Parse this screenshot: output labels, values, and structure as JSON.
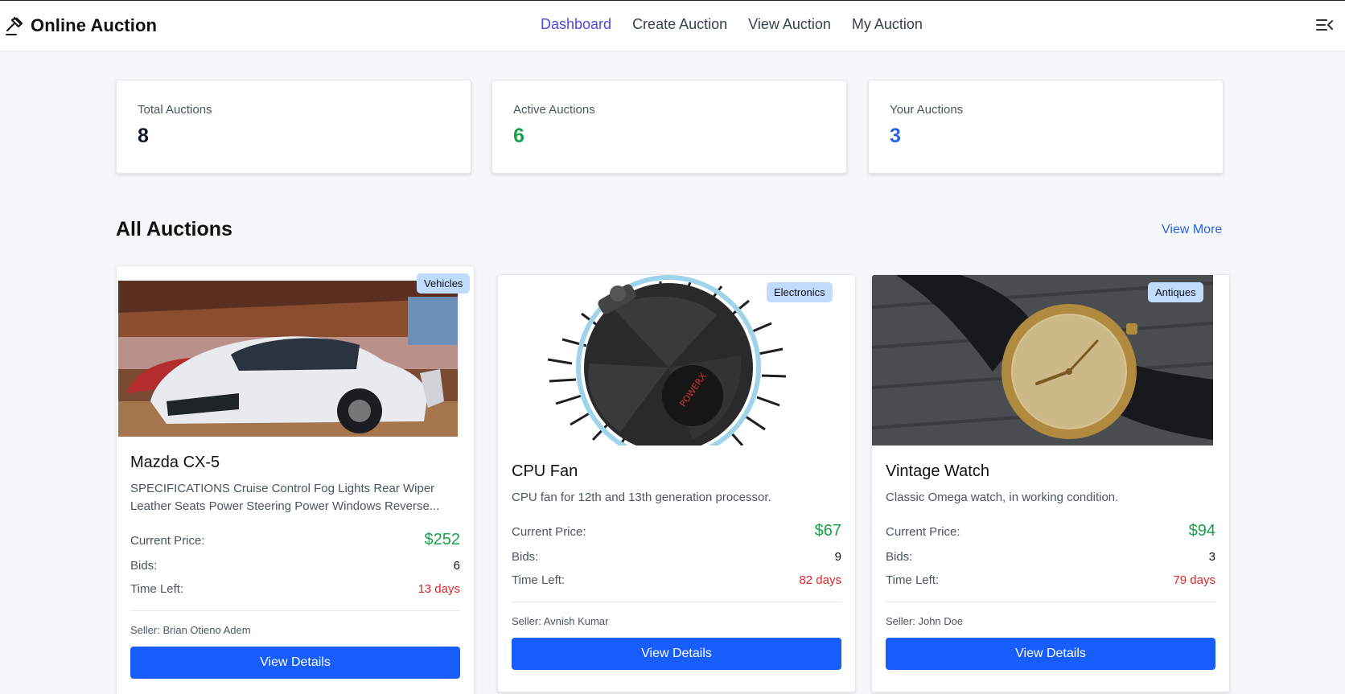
{
  "header": {
    "brand": "Online Auction",
    "nav": [
      "Dashboard",
      "Create Auction",
      "View Auction",
      "My Auction"
    ],
    "active_nav": "Dashboard"
  },
  "stats": [
    {
      "label": "Total Auctions",
      "value": "8",
      "color": "#111827"
    },
    {
      "label": "Active Auctions",
      "value": "6",
      "color": "#16a34a"
    },
    {
      "label": "Your Auctions",
      "value": "3",
      "color": "#2563eb"
    }
  ],
  "section": {
    "title": "All Auctions",
    "view_more": "View More"
  },
  "labels": {
    "current_price": "Current Price:",
    "bids": "Bids:",
    "time_left": "Time Left:",
    "view_details": "View Details"
  },
  "auctions": [
    {
      "category": "Vehicles",
      "title": "Mazda CX-5",
      "description": "SPECIFICATIONS Cruise Control Fog Lights Rear Wiper Leather Seats Power Steering Power Windows Reverse...",
      "price": "$252",
      "bids": "6",
      "time_left": "13 days",
      "seller": "Seller: Brian Otieno Adem",
      "image": "white-suv-photo"
    },
    {
      "category": "Electronics",
      "title": "CPU Fan",
      "description": "CPU fan for 12th and 13th generation processor.",
      "price": "$67",
      "bids": "9",
      "time_left": "82 days",
      "seller": "Seller: Avnish Kumar",
      "image": "cpu-cooler-photo"
    },
    {
      "category": "Antiques",
      "title": "Vintage Watch",
      "description": "Classic Omega watch, in working condition.",
      "price": "$94",
      "bids": "3",
      "time_left": "79 days",
      "seller": "Seller: John Doe",
      "image": "gold-watch-photo"
    }
  ],
  "colors": {
    "accent": "#4f46e5",
    "button": "#175dfb",
    "price": "#16a34a",
    "time": "#dc2626",
    "badge": "#bfdbfe"
  }
}
